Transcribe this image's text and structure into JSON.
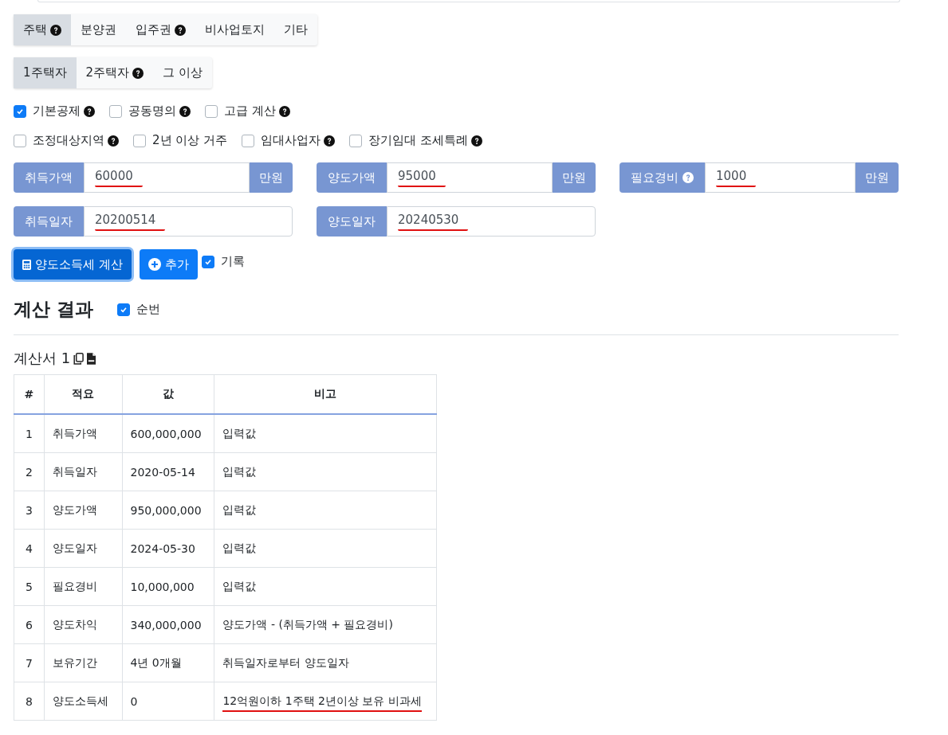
{
  "asset_tabs": [
    {
      "label": "주택",
      "help": true,
      "selected": true
    },
    {
      "label": "분양권",
      "help": false,
      "selected": false
    },
    {
      "label": "입주권",
      "help": true,
      "selected": false
    },
    {
      "label": "비사업토지",
      "help": false,
      "selected": false
    },
    {
      "label": "기타",
      "help": false,
      "selected": false
    }
  ],
  "owner_tabs": [
    {
      "label": "1주택자",
      "help": false,
      "selected": true
    },
    {
      "label": "2주택자",
      "help": true,
      "selected": false
    },
    {
      "label": "그 이상",
      "help": false,
      "selected": false
    }
  ],
  "option_rows": [
    [
      {
        "label": "기본공제",
        "help": true,
        "checked": true
      },
      {
        "label": "공동명의",
        "help": true,
        "checked": false
      },
      {
        "label": "고급 계산",
        "help": true,
        "checked": false
      }
    ],
    [
      {
        "label": "조정대상지역",
        "help": true,
        "checked": false
      },
      {
        "label": "2년 이상 거주",
        "help": false,
        "checked": false
      },
      {
        "label": "임대사업자",
        "help": true,
        "checked": false
      },
      {
        "label": "장기임대 조세특례",
        "help": true,
        "checked": false
      }
    ]
  ],
  "field_rows": [
    [
      {
        "label": "취득가액",
        "help": false,
        "value": "60000",
        "unit": "만원",
        "underlined": true
      },
      {
        "label": "양도가액",
        "help": false,
        "value": "95000",
        "unit": "만원",
        "underlined": true
      },
      {
        "label": "필요경비",
        "help": true,
        "value": "1000",
        "unit": "만원",
        "underlined": true
      }
    ],
    [
      {
        "label": "취득일자",
        "help": false,
        "value": "20200514",
        "underlined": true
      },
      {
        "label": "양도일자",
        "help": false,
        "value": "20240530",
        "underlined": true
      }
    ]
  ],
  "calculate_button": "양도소득세 계산",
  "add_button": "추가",
  "record_option": {
    "label": "기록",
    "checked": true
  },
  "results_heading": "계산 결과",
  "serial_option": {
    "label": "순번",
    "checked": true
  },
  "sheet_title": "계산서 1",
  "table": {
    "columns": [
      "#",
      "적요",
      "값",
      "비고"
    ],
    "rows": [
      {
        "no": "1",
        "item": "취득가액",
        "value": "600,000,000",
        "note": "입력값",
        "underlined": false
      },
      {
        "no": "2",
        "item": "취득일자",
        "value": "2020-05-14",
        "note": "입력값",
        "underlined": false
      },
      {
        "no": "3",
        "item": "양도가액",
        "value": "950,000,000",
        "note": "입력값",
        "underlined": false
      },
      {
        "no": "4",
        "item": "양도일자",
        "value": "2024-05-30",
        "note": "입력값",
        "underlined": false
      },
      {
        "no": "5",
        "item": "필요경비",
        "value": "10,000,000",
        "note": "입력값",
        "underlined": false
      },
      {
        "no": "6",
        "item": "양도차익",
        "value": "340,000,000",
        "note": "양도가액 - (취득가액 + 필요경비)",
        "underlined": false
      },
      {
        "no": "7",
        "item": "보유기간",
        "value": "4년 0개월",
        "note": "취득일자로부터 양도일자",
        "underlined": false
      },
      {
        "no": "8",
        "item": "양도소득세",
        "value": "0",
        "note": "12억원이하 1주택 2년이상 보유 비과세",
        "underlined": true
      }
    ]
  }
}
